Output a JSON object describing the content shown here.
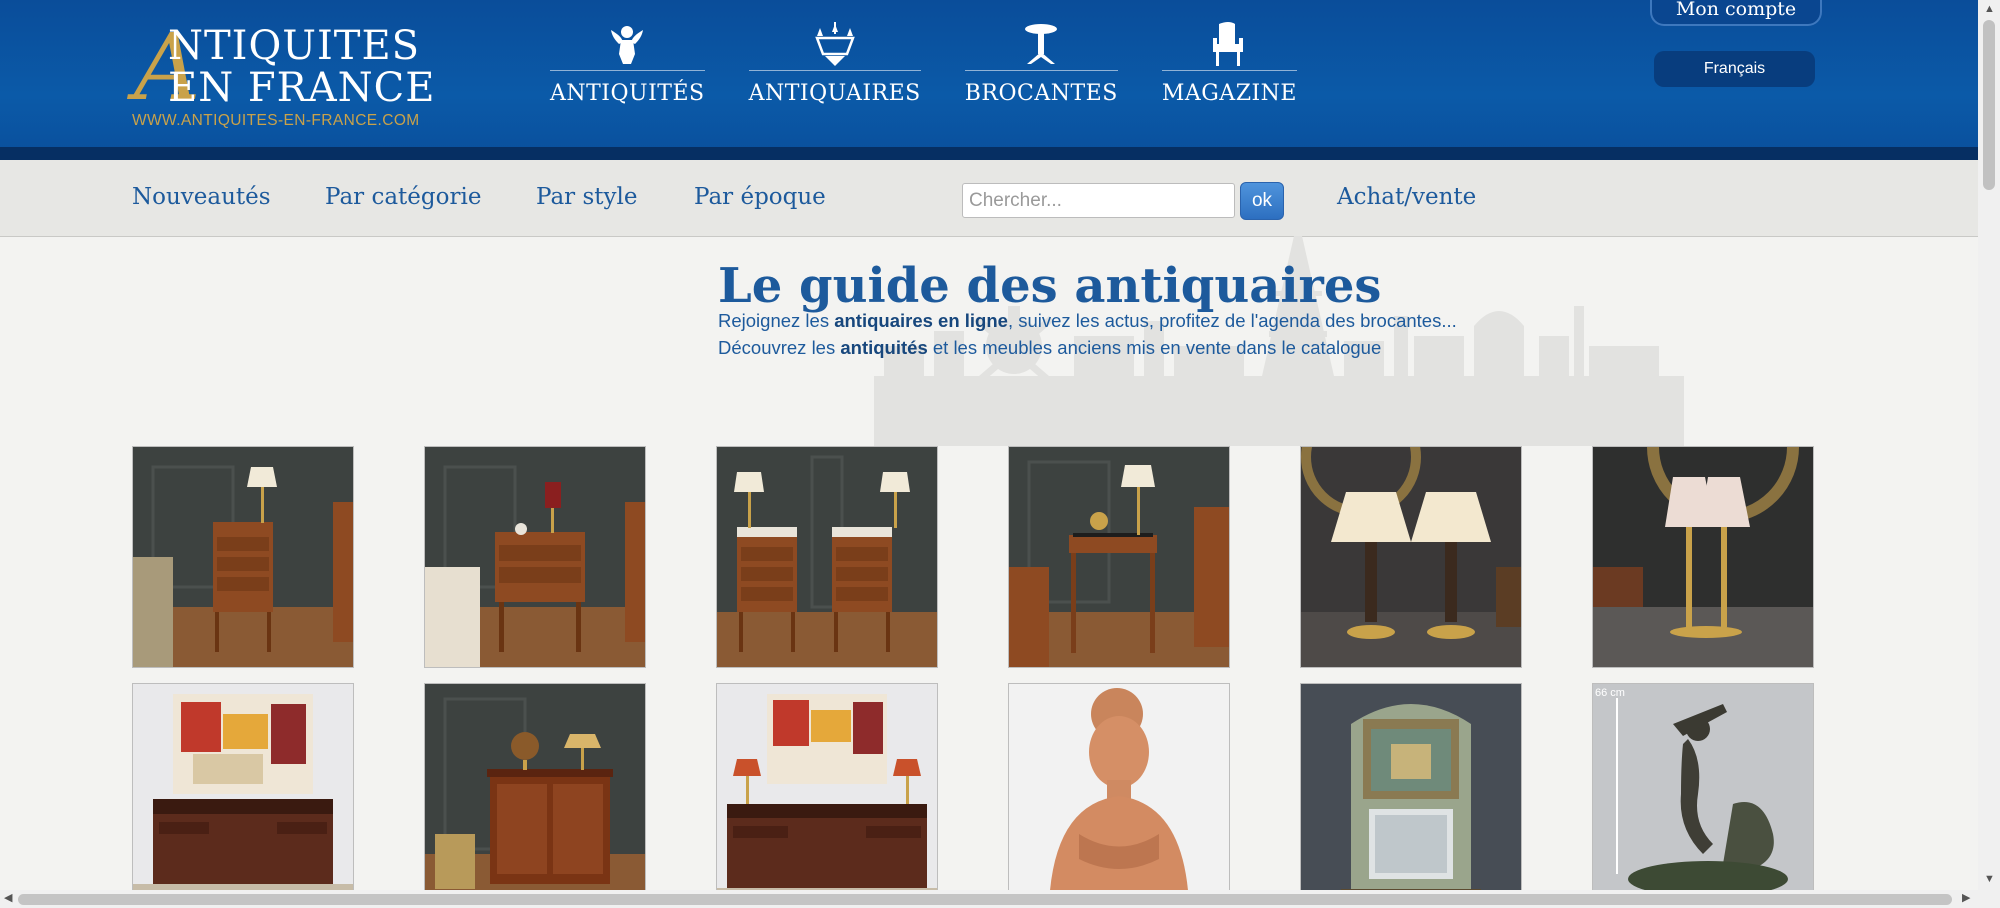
{
  "header": {
    "logo": {
      "big_letter": "A",
      "line1": "NTIQUITES",
      "line2": "EN FRANCE",
      "url": "WWW.ANTIQUITES-EN-FRANCE.COM"
    },
    "main_nav": [
      {
        "label": "ANTIQUITÉS",
        "icon": "cherub-icon"
      },
      {
        "label": "ANTIQUAIRES",
        "icon": "chandelier-icon"
      },
      {
        "label": "BROCANTES",
        "icon": "pedestal-table-icon"
      },
      {
        "label": "MAGAZINE",
        "icon": "armchair-icon"
      }
    ],
    "account_label": "Mon compte",
    "language_label": "Français"
  },
  "sub_nav": {
    "links": [
      "Nouveautés",
      "Par catégorie",
      "Par style",
      "Par époque",
      "Achat/vente"
    ],
    "search_placeholder": "Chercher...",
    "search_value": "",
    "ok_label": "ok"
  },
  "hero": {
    "title": "Le guide des antiquaires",
    "line1_pre": "Rejoignez les ",
    "line1_bold": "antiquaires en ligne",
    "line1_post": ", suivez les actus, profitez de l'agenda des brocantes...",
    "line2_pre": "Découvrez les ",
    "line2_bold": "antiquités",
    "line2_post": " et les meubles anciens mis en vente dans le catalogue"
  },
  "products": {
    "row1": [
      "night-table-photo",
      "chest-nightstand-photo",
      "pair-nightstands-photo",
      "side-table-photo",
      "pair-lamps-photo",
      "table-lamps-photo"
    ],
    "row2": [
      "desk-painting-photo",
      "buffet-photo",
      "desk-painting-lamps-photo",
      "terracotta-bust-photo",
      "trumeau-mirror-photo",
      "bronze-sculpture-photo"
    ],
    "sculpture_measure": "66 cm"
  },
  "colors": {
    "header_blue": "#0b5aa8",
    "header_band": "#062f63",
    "gold": "#c9a24a",
    "link_blue": "#1d5a9c",
    "page_bg": "#f3f3f1"
  }
}
